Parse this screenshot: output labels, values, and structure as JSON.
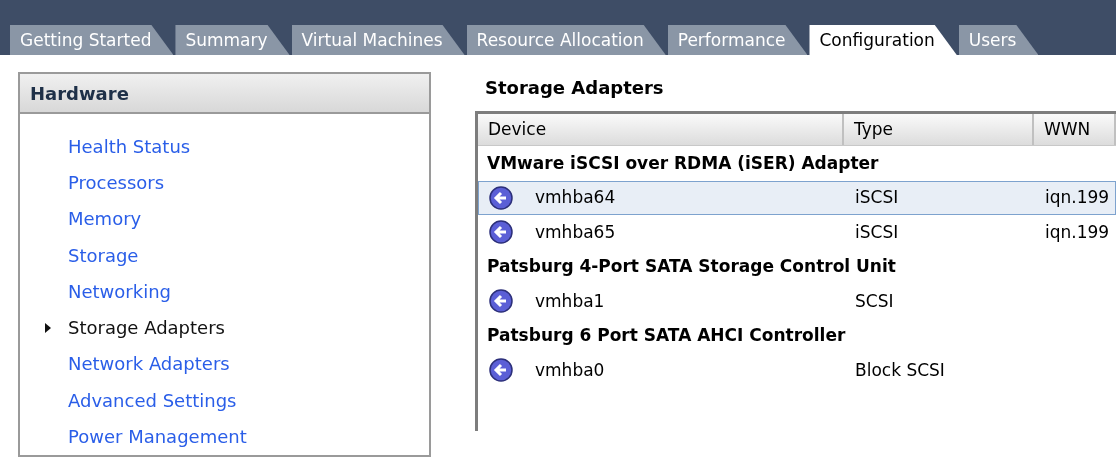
{
  "tabs": [
    {
      "label": "Getting Started",
      "selected": false
    },
    {
      "label": "Summary",
      "selected": false
    },
    {
      "label": "Virtual Machines",
      "selected": false
    },
    {
      "label": "Resource Allocation",
      "selected": false
    },
    {
      "label": "Performance",
      "selected": false
    },
    {
      "label": "Configuration",
      "selected": true
    },
    {
      "label": "Users",
      "selected": false
    }
  ],
  "sidebar": {
    "title": "Hardware",
    "items": [
      {
        "label": "Health Status",
        "selected": false
      },
      {
        "label": "Processors",
        "selected": false
      },
      {
        "label": "Memory",
        "selected": false
      },
      {
        "label": "Storage",
        "selected": false
      },
      {
        "label": "Networking",
        "selected": false
      },
      {
        "label": "Storage Adapters",
        "selected": true
      },
      {
        "label": "Network Adapters",
        "selected": false
      },
      {
        "label": "Advanced Settings",
        "selected": false
      },
      {
        "label": "Power Management",
        "selected": false
      }
    ]
  },
  "content": {
    "title": "Storage Adapters",
    "table": {
      "columns": [
        "Device",
        "Type",
        "WWN"
      ],
      "rows": [
        {
          "kind": "group",
          "label": "VMware iSCSI over RDMA (iSER) Adapter"
        },
        {
          "kind": "device",
          "device": "vmhba64",
          "type": "iSCSI",
          "wwn": "iqn.199",
          "selected": true
        },
        {
          "kind": "device",
          "device": "vmhba65",
          "type": "iSCSI",
          "wwn": "iqn.199",
          "selected": false
        },
        {
          "kind": "group",
          "label": "Patsburg 4-Port SATA Storage Control Unit"
        },
        {
          "kind": "device",
          "device": "vmhba1",
          "type": "SCSI",
          "selected": false
        },
        {
          "kind": "group",
          "label": "Patsburg 6 Port SATA AHCI Controller"
        },
        {
          "kind": "device",
          "device": "vmhba0",
          "type": "Block SCSI",
          "selected": false
        }
      ]
    }
  }
}
